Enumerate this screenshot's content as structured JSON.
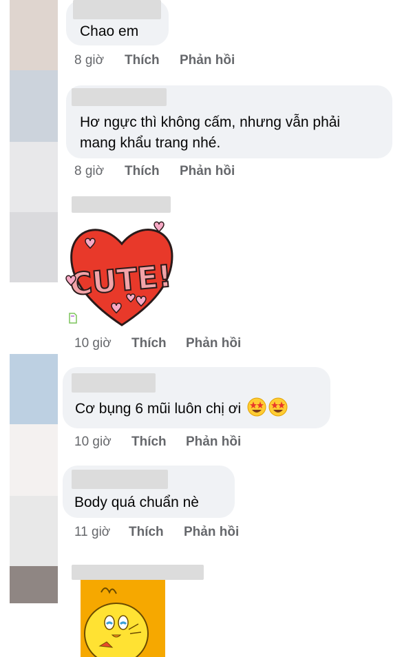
{
  "colors": {
    "bubble": "#f0f2f5",
    "meta_text": "#65676b",
    "text": "#050505",
    "sticker_heart": "#e8392a",
    "sticker_letters": "#f2a3a8",
    "sticker_bg": "#f6a800"
  },
  "comments": [
    {
      "text_lines": [
        "Chao em"
      ],
      "time": "8 giờ",
      "like": "Thích",
      "reply": "Phản hồi"
    },
    {
      "text_lines": [
        "Hơ ngực thì không cấm, nhưng vẫn phải",
        "mang khẩu trang nhé."
      ],
      "time": "8 giờ",
      "like": "Thích",
      "reply": "Phản hồi"
    },
    {
      "sticker": "CUTE!",
      "sticker_icon": "heart-cute-sticker",
      "time": "10 giờ",
      "like": "Thích",
      "reply": "Phản hồi"
    },
    {
      "text_lines": [
        "Cơ bụng 6 mũi luôn chị ơi"
      ],
      "emoji": "star-struck-emoji",
      "time": "10 giờ",
      "like": "Thích",
      "reply": "Phản hồi"
    },
    {
      "text_lines": [
        "Body quá chuẩn nè"
      ],
      "time": "11 giờ",
      "like": "Thích",
      "reply": "Phản hồi"
    },
    {
      "sticker_icon": "tweety-bird-sticker"
    }
  ]
}
